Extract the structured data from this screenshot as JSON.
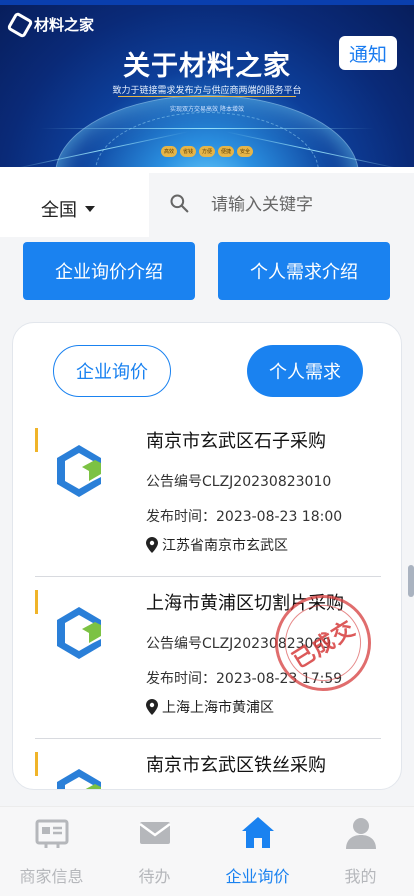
{
  "banner": {
    "logo_text": "材料之家",
    "notice_label": "通知",
    "title": "关于材料之家",
    "subtitle": "致力于链接需求发布方与供应商两端的服务平台",
    "subtitle2": "实现双方交易高效  降本增效",
    "tags": [
      "高效",
      "省钱",
      "方便",
      "便捷",
      "安全"
    ]
  },
  "search": {
    "region": "全国",
    "placeholder": "请输入关键字"
  },
  "intro": {
    "company_label": "企业询价介绍",
    "personal_label": "个人需求介绍"
  },
  "tabs": {
    "company": "企业询价",
    "personal": "个人需求",
    "active": "个人需求"
  },
  "listings": [
    {
      "title": "南京市玄武区石子采购",
      "code": "公告编号CLZJ20230823010",
      "time": "发布时间：2023-08-23 18:00",
      "location": "江苏省南京市玄武区",
      "stamp": ""
    },
    {
      "title": "上海市黄浦区切割片采购",
      "code": "公告编号CLZJ20230823009",
      "time": "发布时间：2023-08-23 17:59",
      "location": "上海上海市黄浦区",
      "stamp": "已成交"
    },
    {
      "title": "南京市玄武区铁丝采购",
      "code": "",
      "time": "",
      "location": "",
      "stamp": ""
    }
  ],
  "nav": {
    "items": [
      {
        "label": "商家信息",
        "icon": "merchant-info-icon"
      },
      {
        "label": "待办",
        "icon": "mail-icon"
      },
      {
        "label": "企业询价",
        "icon": "home-icon"
      },
      {
        "label": "我的",
        "icon": "user-icon"
      }
    ],
    "active_index": 2
  },
  "colors": {
    "accent": "#1a82f0",
    "marker": "#f0b429",
    "stamp": "#d63c3c"
  }
}
